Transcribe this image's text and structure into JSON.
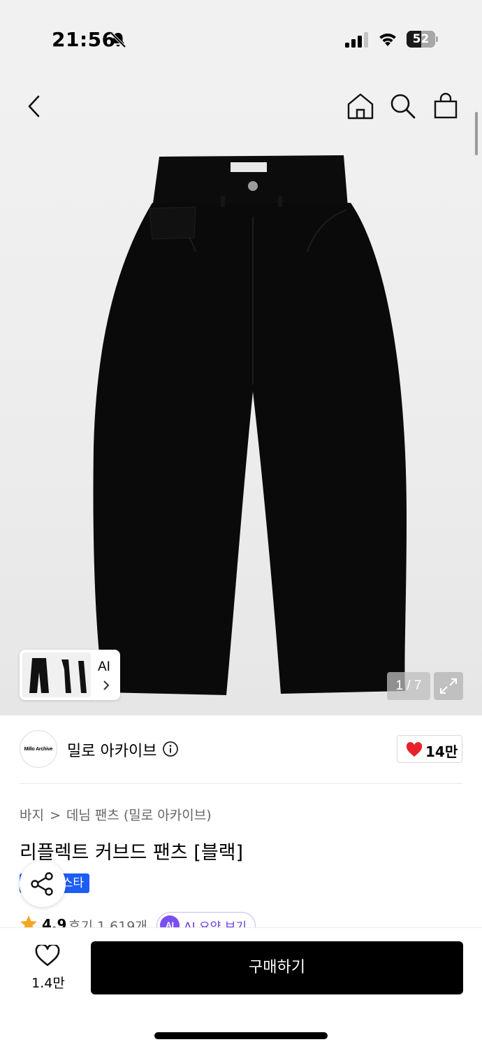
{
  "status_bar": {
    "time": "21:56",
    "battery": "52",
    "battery_level": 0.52
  },
  "nav": {
    "icons": [
      "back-icon",
      "home-icon",
      "search-icon",
      "bag-icon"
    ]
  },
  "gallery": {
    "ai_label": "AI",
    "counter": "1 / 7"
  },
  "brand": {
    "logo_text": "Millo Archive",
    "name": "밀로 아카이브",
    "likes": "14만",
    "heart_color": "#e8212b"
  },
  "breadcrumb": {
    "category": "바지",
    "separator": ">",
    "subcategory": "데님 팬츠 (밀로 아카이브)"
  },
  "product": {
    "title": "리플렉트 커브드 팬츠 [블랙]",
    "badge": "스타",
    "rating": "4.9",
    "reviews": "후기 1,619개",
    "ai_chip_icon": "AI",
    "ai_chip_label": "AI 요약 보기"
  },
  "bottom": {
    "fav_count": "1.4만",
    "buy_label": "구매하기"
  },
  "colors": {
    "accent_blue": "#1d5cf5",
    "ai_purple": "#7b4ef0",
    "star": "#f5a623"
  }
}
